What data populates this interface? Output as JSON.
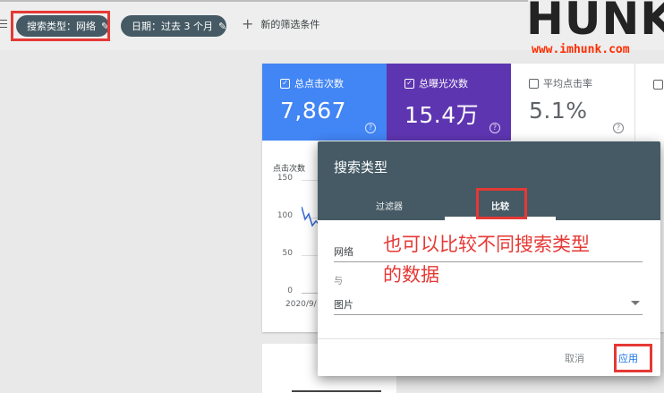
{
  "filter_bar": {
    "chip_search_type": "搜索类型：网络",
    "chip_date": "日期：过去 3 个月",
    "new_filter": "新的筛选条件"
  },
  "logo": {
    "word": "HUNK",
    "url": "www.imhunk.com"
  },
  "metrics": [
    {
      "label": "总点击次数",
      "value": "7,867",
      "checked": true,
      "color": "#4285f4"
    },
    {
      "label": "总曝光次数",
      "value": "15.4万",
      "checked": true,
      "color": "#5e35b1"
    },
    {
      "label": "平均点击率",
      "value": "5.1%",
      "checked": false
    }
  ],
  "chart": {
    "ylabel": "点击次数",
    "yticks": [
      "150",
      "100",
      "50",
      "0"
    ],
    "xlabel_partial": "2020/9/"
  },
  "dialog": {
    "title": "搜索类型",
    "tabs": {
      "filter": "过滤器",
      "compare": "比较"
    },
    "field1_value": "网络",
    "with_label": "与",
    "field2_value": "图片",
    "cancel": "取消",
    "apply": "应用"
  },
  "annotation": {
    "line1": "也可以比较不同搜索类型",
    "line2": "的数据"
  },
  "colors": {
    "highlight": "#e53935",
    "chip_bg": "#455a64",
    "clicks": "#4285f4",
    "impressions": "#5e35b1"
  }
}
